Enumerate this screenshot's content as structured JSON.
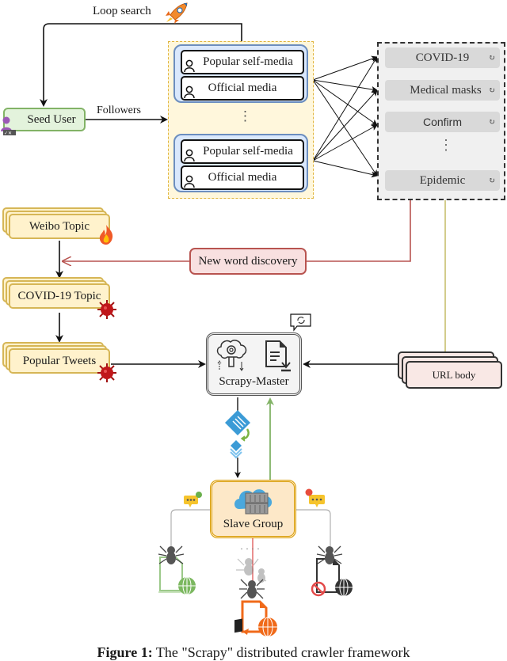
{
  "figure": {
    "caption_label": "Figure 1:",
    "caption_text": " The \"Scrapy\" distributed crawler framework"
  },
  "top": {
    "loop_label": "Loop search",
    "followers_label": "Followers",
    "seed_user": "Seed User"
  },
  "media_group": {
    "items": [
      "Popular self-media",
      "Official media",
      "Popular self-media",
      "Official media"
    ],
    "ellipsis": "⋮"
  },
  "keywords": {
    "items": [
      "COVID-19",
      "Medical masks",
      "Confirm",
      "Epidemic"
    ],
    "ellipsis": "⋮",
    "refresh_glyph": "↻"
  },
  "topics": {
    "weibo": "Weibo Topic",
    "covid": "COVID-19 Topic",
    "tweets": "Popular Tweets"
  },
  "new_word": "New word discovery",
  "master": {
    "label": "Scrapy-Master"
  },
  "url_body": "URL body",
  "slave": {
    "label": "Slave Group",
    "ellipsis": "· · · ·"
  },
  "colors": {
    "red_line": "#b85450",
    "olive_line": "#c8c070",
    "green_line": "#82b366",
    "gray_line": "#b0b0b0"
  }
}
